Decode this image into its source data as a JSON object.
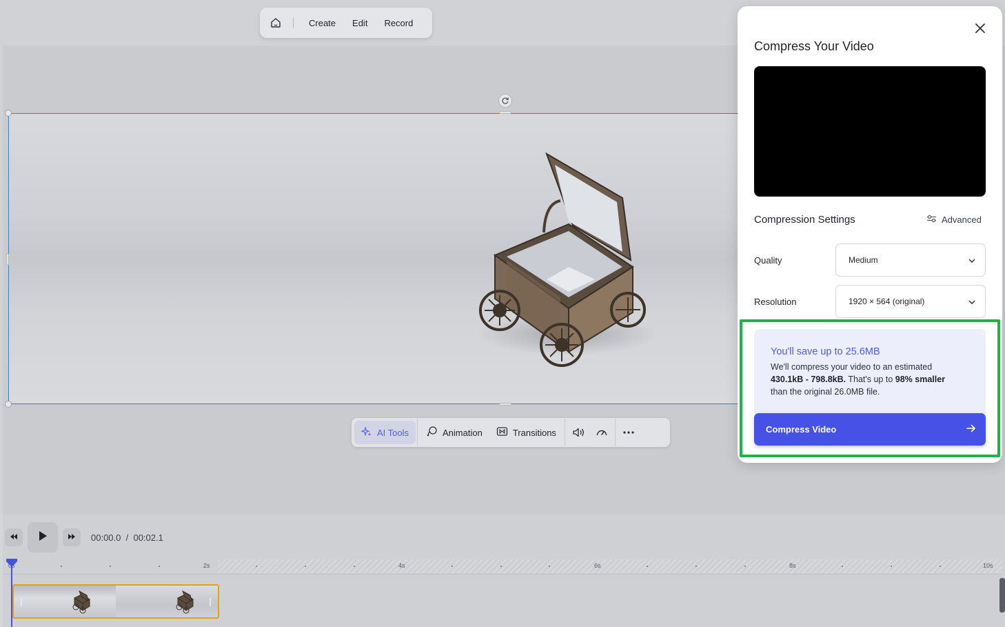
{
  "top_menu": {
    "home_icon": "home-icon",
    "items": [
      "Create",
      "Edit",
      "Record"
    ]
  },
  "toolbar": {
    "ai_tools": "AI Tools",
    "animation": "Animation",
    "transitions": "Transitions",
    "volume_icon": "volume-icon",
    "speed_icon": "speed-icon",
    "more_icon": "more-icon"
  },
  "modal": {
    "title": "Compress Your Video",
    "close_icon": "close-icon",
    "settings_title": "Compression Settings",
    "advanced_label": "Advanced",
    "quality_label": "Quality",
    "quality_value": "Medium",
    "resolution_label": "Resolution",
    "resolution_value": "1920 × 564 (original)",
    "save_title": "You'll save up to 25.6MB",
    "save_text_1": "We'll compress your video to an estimated",
    "save_range": "430.1kB - 798.8kB.",
    "save_text_2": "That's up to",
    "save_percent": "98% smaller",
    "save_text_3": "than the original 26.0MB file.",
    "compress_button": "Compress Video"
  },
  "player": {
    "current_time": "00:00.0",
    "separator": "/",
    "duration": "00:02.1",
    "ruler_labels": [
      "0s",
      "2s",
      "4s",
      "6s",
      "8s",
      "10s"
    ]
  },
  "colors": {
    "accent": "#4652e6",
    "highlight": "#1fb14a",
    "clip_border": "#e0a21a"
  }
}
